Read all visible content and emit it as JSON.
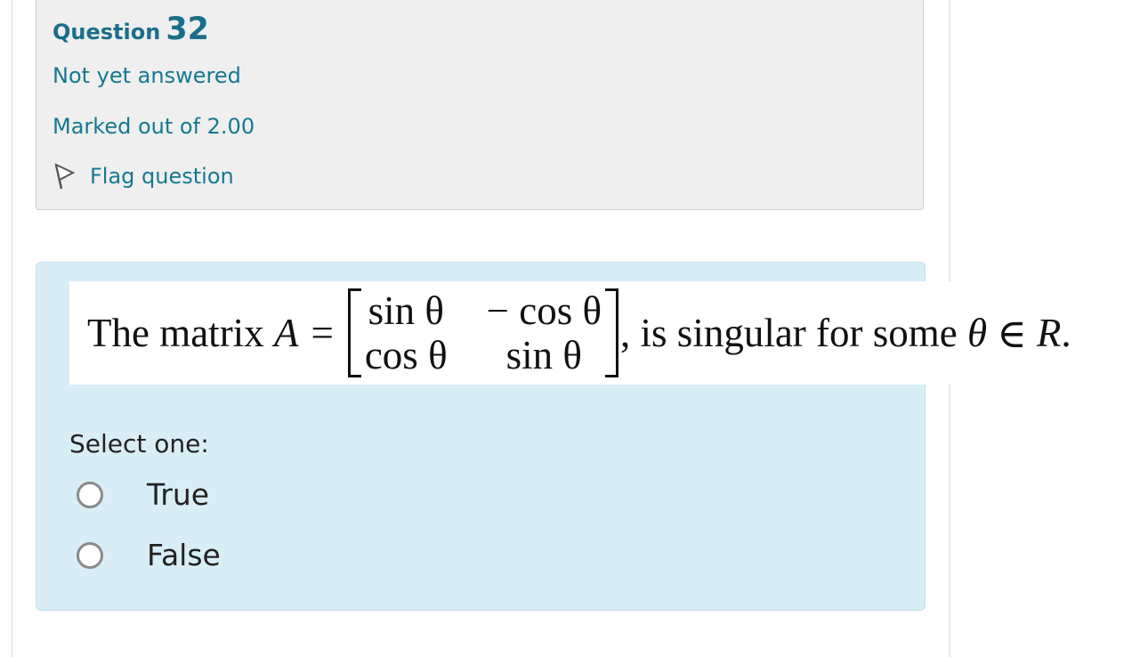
{
  "question": {
    "label": "Question",
    "number": "32",
    "state": "Not yet answered",
    "grade": "Marked out of 2.00",
    "flag_label": "Flag question"
  },
  "qtext": {
    "prefix": "The matrix",
    "variable": "A",
    "equals": "=",
    "matrix": [
      [
        "sin θ",
        "− cos θ"
      ],
      [
        "cos θ",
        "sin θ"
      ]
    ],
    "suffix_1": ", is singular for some ",
    "theta": "θ",
    "element_of": " ∈ ",
    "set": "R",
    "period": "."
  },
  "answer": {
    "prompt": "Select one:",
    "options": [
      {
        "label": "True",
        "selected": false
      },
      {
        "label": "False",
        "selected": false
      }
    ]
  },
  "colors": {
    "accent": "#167891",
    "info_bg": "#efefef",
    "content_bg": "#d9edf7"
  },
  "icons": {
    "flag": "flag-icon",
    "radio": "radio-icon"
  }
}
